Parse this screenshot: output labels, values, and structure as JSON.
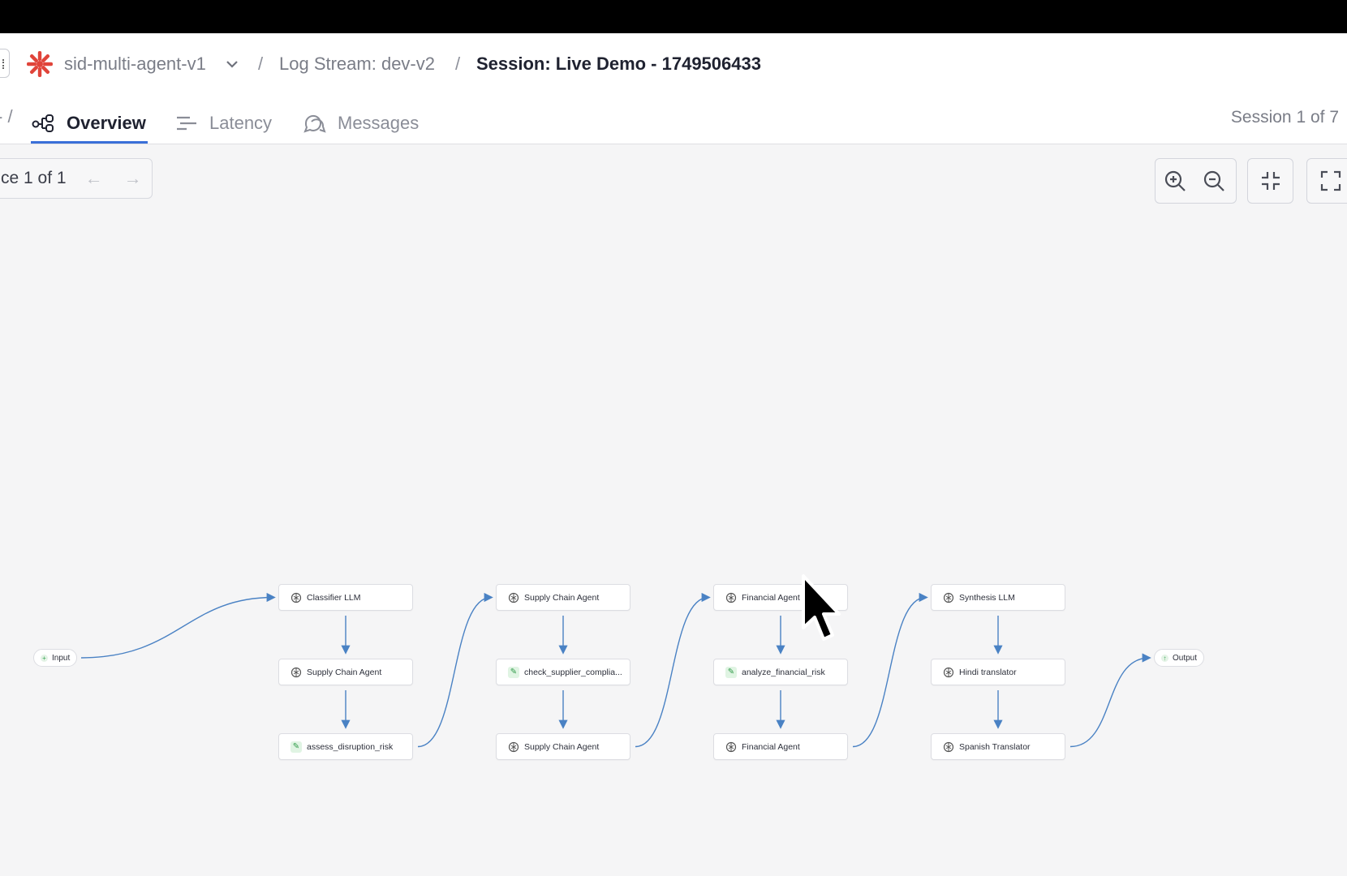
{
  "breadcrumb": {
    "project": "sid-multi-agent-v1",
    "log_stream": "Log Stream: dev-v2",
    "session": "Session: Live Demo - 1749506433",
    "separator": "/"
  },
  "tabs": [
    {
      "label": "Overview",
      "icon": "graph-nodes-icon",
      "active": true
    },
    {
      "label": "Latency",
      "icon": "bars-icon",
      "active": false
    },
    {
      "label": "Messages",
      "icon": "chat-bubbles-icon",
      "active": false
    }
  ],
  "session_counter": "Session 1 of 7",
  "trace_pager": {
    "label": "ce 1 of 1",
    "prev": "←",
    "next": "→"
  },
  "controls": [
    "zoom-in-icon",
    "zoom-out-icon",
    "collapse-icon",
    "fullscreen-icon"
  ],
  "graph": {
    "input_label": "Input",
    "output_label": "Output",
    "columns": [
      [
        {
          "label": "Classifier LLM",
          "kind": "llm"
        },
        {
          "label": "Supply Chain Agent",
          "kind": "llm"
        },
        {
          "label": "assess_disruption_risk",
          "kind": "tool"
        }
      ],
      [
        {
          "label": "Supply Chain Agent",
          "kind": "llm"
        },
        {
          "label": "check_supplier_complia...",
          "kind": "tool"
        },
        {
          "label": "Supply Chain Agent",
          "kind": "llm"
        }
      ],
      [
        {
          "label": "Financial Agent",
          "kind": "llm"
        },
        {
          "label": "analyze_financial_risk",
          "kind": "tool"
        },
        {
          "label": "Financial Agent",
          "kind": "llm"
        }
      ],
      [
        {
          "label": "Synthesis LLM",
          "kind": "llm"
        },
        {
          "label": "Hindi translator",
          "kind": "llm"
        },
        {
          "label": "Spanish Translator",
          "kind": "llm"
        }
      ]
    ]
  },
  "colors": {
    "edge": "#4a82c4",
    "accent": "#3a6fd8",
    "logo": "#e0443a"
  }
}
